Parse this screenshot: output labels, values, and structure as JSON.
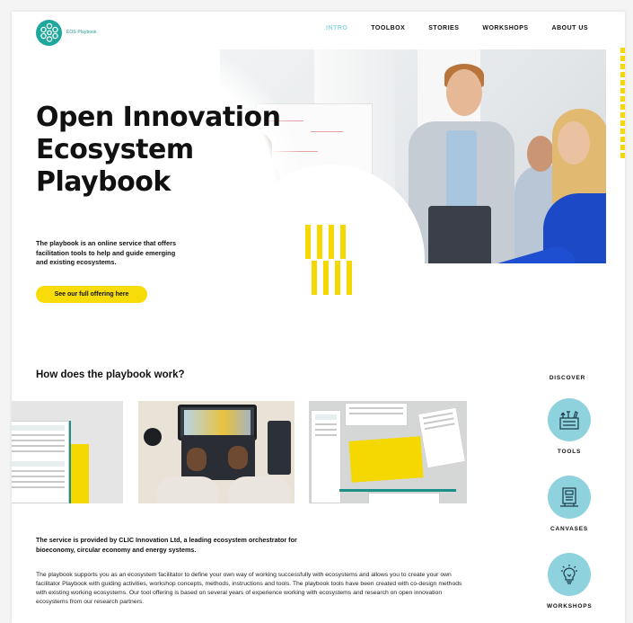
{
  "header": {
    "logo_text": "EOS Playbook",
    "nav": [
      {
        "label": "INTRO",
        "active": true
      },
      {
        "label": "TOOLBOX",
        "active": false
      },
      {
        "label": "STORIES",
        "active": false
      },
      {
        "label": "WORKSHOPS",
        "active": false
      },
      {
        "label": "ABOUT US",
        "active": false
      }
    ]
  },
  "hero": {
    "title_lines": [
      "Open Innovation",
      "Ecosystem",
      "Playbook"
    ],
    "description": "The playbook is an online service that offers facilitation tools to help and guide emerging and existing ecosystems.",
    "cta_label": "See our full offering here"
  },
  "how": {
    "title": "How does the playbook work?"
  },
  "provider": {
    "intro": "The service is provided  by CLIC Innovation Ltd, a leading ecosystem orchestrator for bioeconomy, circular economy and energy systems.",
    "body": " The playbook supports you as an ecosystem facilitator to define your own way of working successfully with ecosystems and allows you to create your own facilitator Playbook with guiding activities, workshop concepts, methods, instructions and tools. The playbook tools have been created with co-design methods with existing working ecosystems. Our tool offering is based on several years of experience working with ecosystems and research on open innovation ecosystems from our research partners."
  },
  "discover": {
    "title": "DISCOVER",
    "items": [
      {
        "label": "TOOLS",
        "icon": "tools-icon"
      },
      {
        "label": "CANVASES",
        "icon": "canvas-icon"
      },
      {
        "label": "WORKSHOPS",
        "icon": "lightbulb-icon"
      }
    ]
  },
  "colors": {
    "accent_yellow": "#f7dc0a",
    "teal": "#1ea79c",
    "light_teal": "#8ed2dd",
    "nav_active": "#8fd6e2"
  }
}
